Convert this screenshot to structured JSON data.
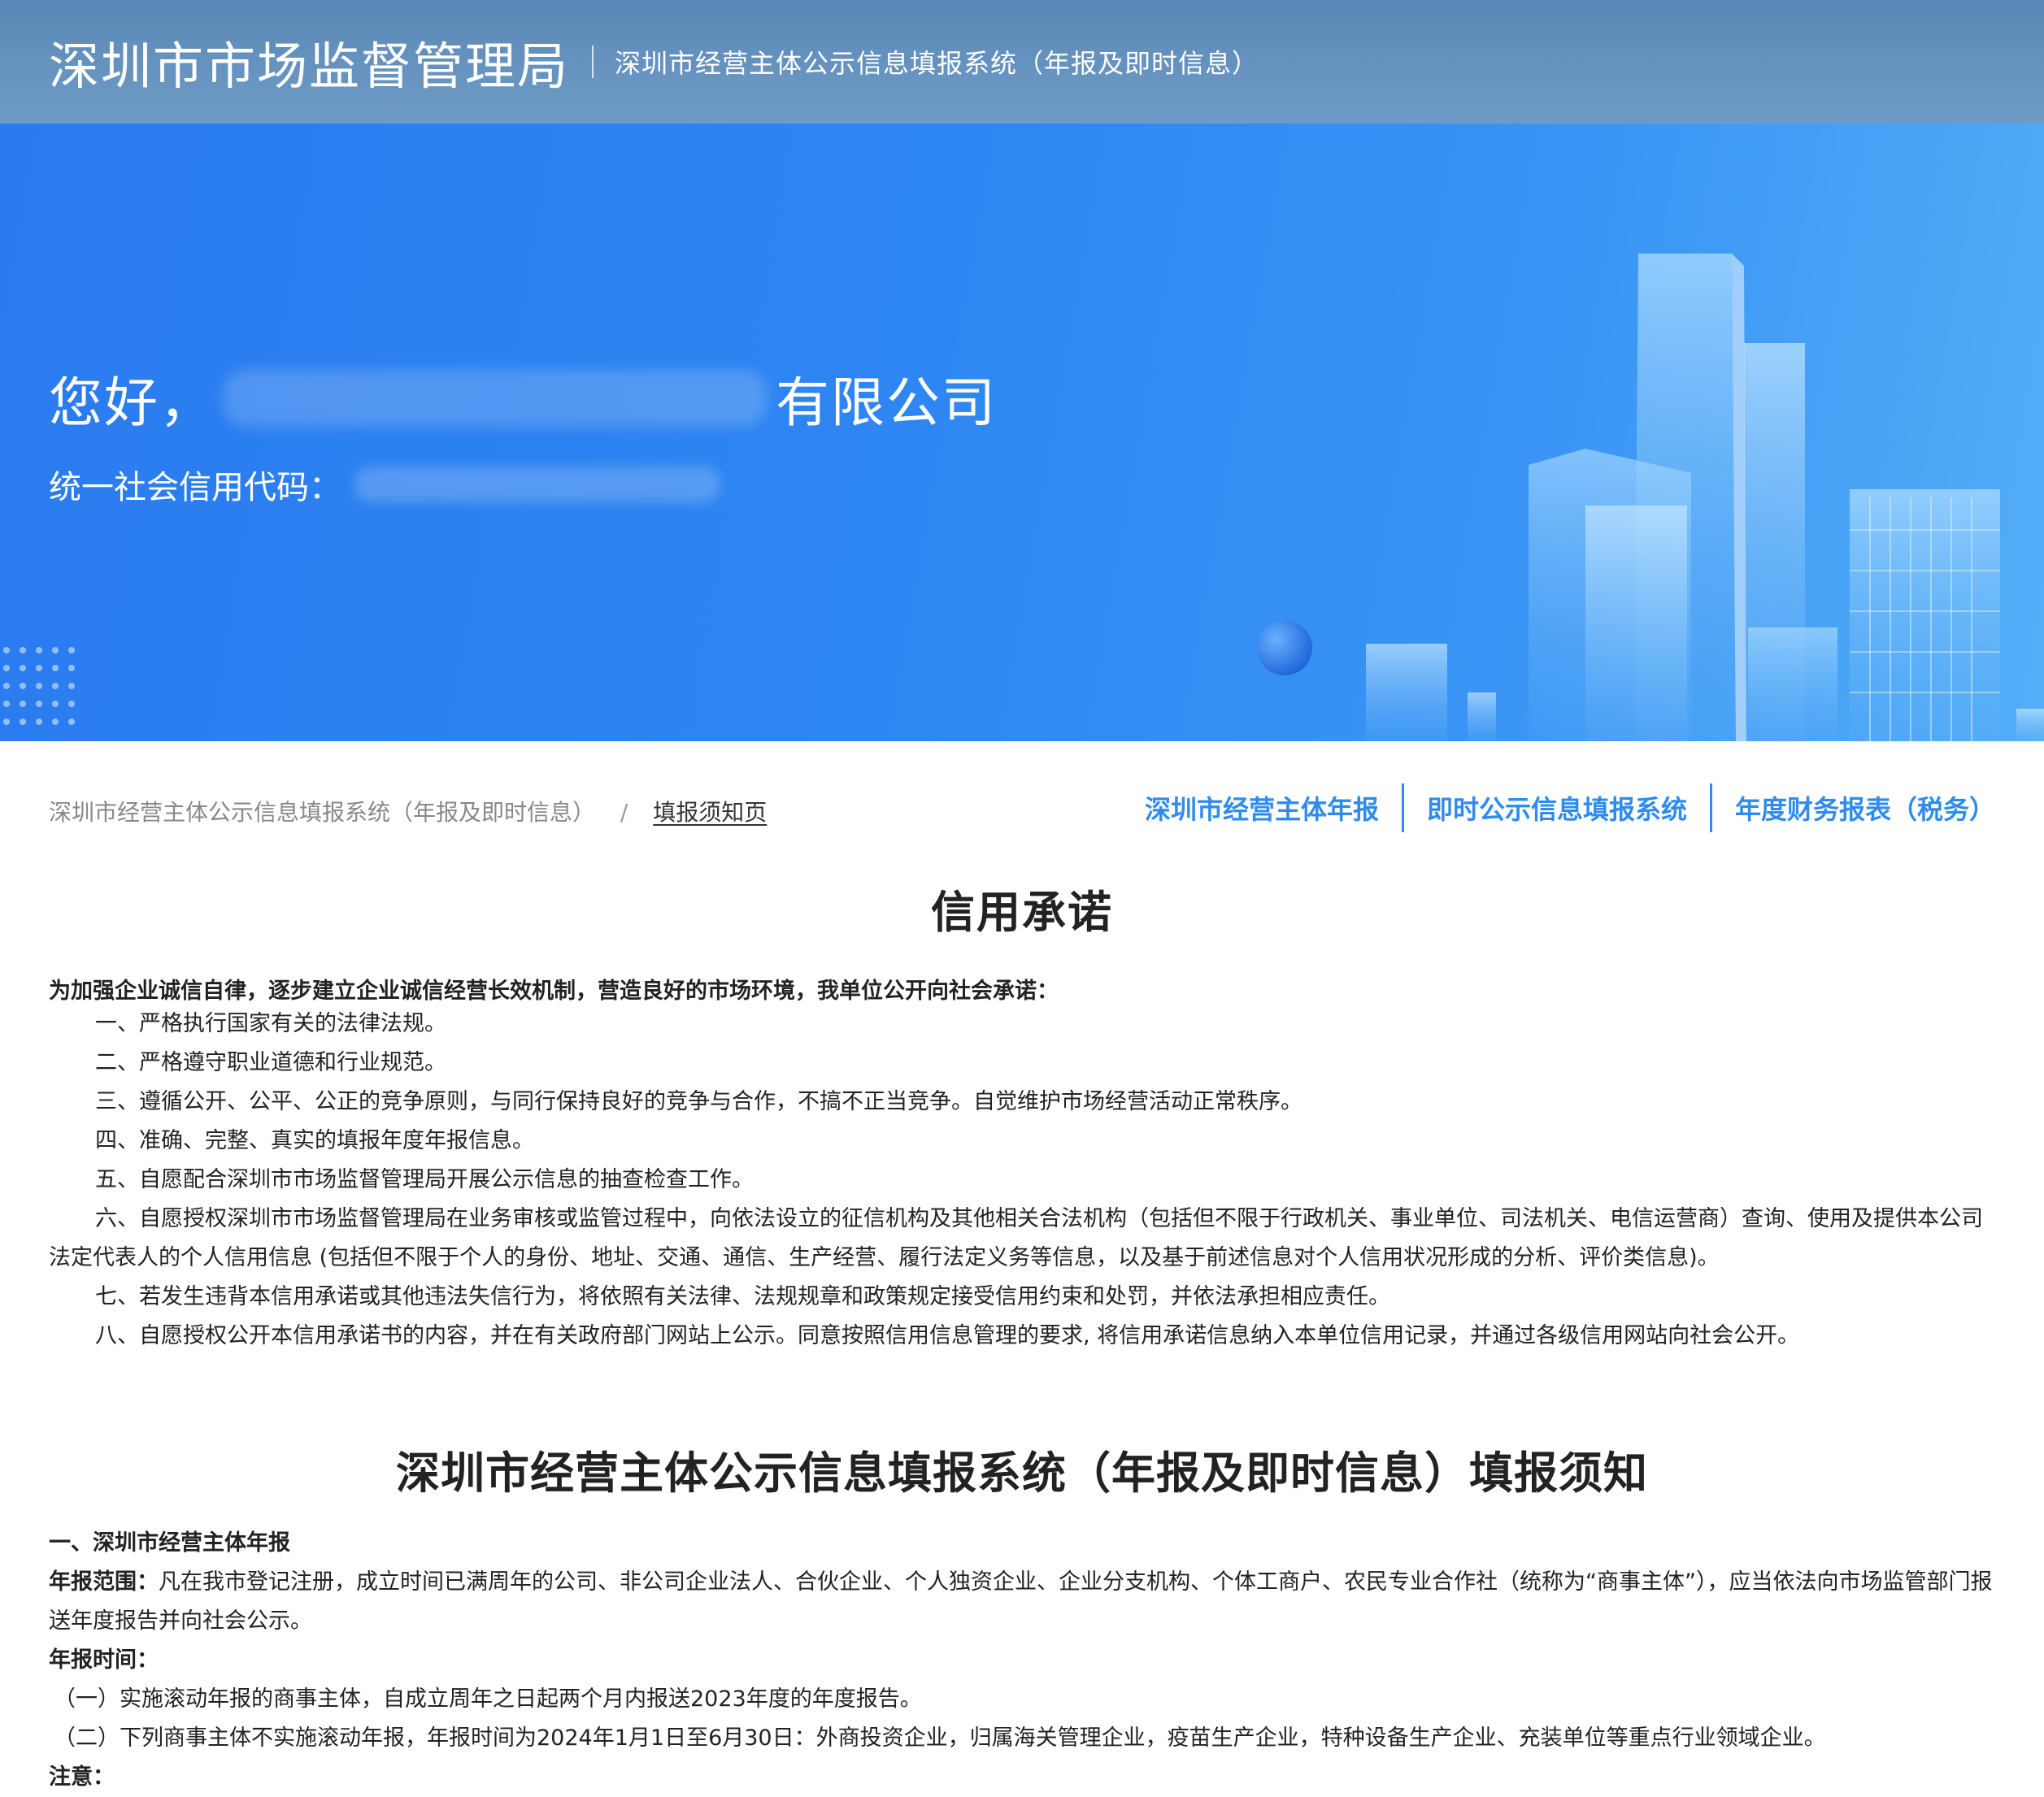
{
  "header": {
    "org_name": "深圳市市场监督管理局",
    "system_name": "深圳市经营主体公示信息填报系统（年报及即时信息）"
  },
  "banner": {
    "greeting_prefix": "您好，",
    "company_suffix": "有限公司",
    "credit_code_label": "统一社会信用代码："
  },
  "breadcrumb": {
    "root": "深圳市经营主体公示信息填报系统（年报及即时信息）",
    "separator": "/",
    "current": "填报须知页"
  },
  "nav": {
    "annual_report": "深圳市经营主体年报",
    "instant_info": "即时公示信息填报系统",
    "financial_report": "年度财务报表（税务）"
  },
  "promise": {
    "title": "信用承诺",
    "lead": "为加强企业诚信自律，逐步建立企业诚信经营长效机制，营造良好的市场环境，我单位公开向社会承诺：",
    "items": [
      "一、严格执行国家有关的法律法规。",
      "二、严格遵守职业道德和行业规范。",
      "三、遵循公开、公平、公正的竞争原则，与同行保持良好的竞争与合作，不搞不正当竞争。自觉维护市场经营活动正常秩序。",
      "四、准确、完整、真实的填报年度年报信息。",
      "五、自愿配合深圳市市场监督管理局开展公示信息的抽查检查工作。",
      "六、自愿授权深圳市市场监督管理局在业务审核或监管过程中，向依法设立的征信机构及其他相关合法机构（包括但不限于行政机关、事业单位、司法机关、电信运营商）查询、使用及提供本公司法定代表人的个人信用信息 (包括但不限于个人的身份、地址、交通、通信、生产经营、履行法定义务等信息，以及基于前述信息对个人信用状况形成的分析、评价类信息)。",
      "七、若发生违背本信用承诺或其他违法失信行为，将依照有关法律、法规规章和政策规定接受信用约束和处罚，并依法承担相应责任。",
      "八、自愿授权公开本信用承诺书的内容，并在有关政府部门网站上公示。同意按照信用信息管理的要求, 将信用承诺信息纳入本单位信用记录，并通过各级信用网站向社会公开。"
    ]
  },
  "notice": {
    "title": "深圳市经营主体公示信息填报系统（年报及即时信息）填报须知",
    "section1_title": "一、深圳市经营主体年报",
    "scope_label": "年报范围：",
    "scope_text": "凡在我市登记注册，成立时间已满周年的公司、非公司企业法人、合伙企业、个人独资企业、企业分支机构、个体工商户、农民专业合作社（统称为“商事主体”），应当依法向市场监管部门报送年度报告并向社会公示。",
    "time_label": "年报时间：",
    "time_items": [
      "（一）实施滚动年报的商事主体，自成立周年之日起两个月内报送2023年度的年度报告。",
      "（二）下列商事主体不实施滚动年报，年报时间为2024年1月1日至6月30日：外商投资企业，归属海关管理企业，疫苗生产企业，特种设备生产企业、充装单位等重点行业领域企业。"
    ],
    "note_label": "注意："
  }
}
